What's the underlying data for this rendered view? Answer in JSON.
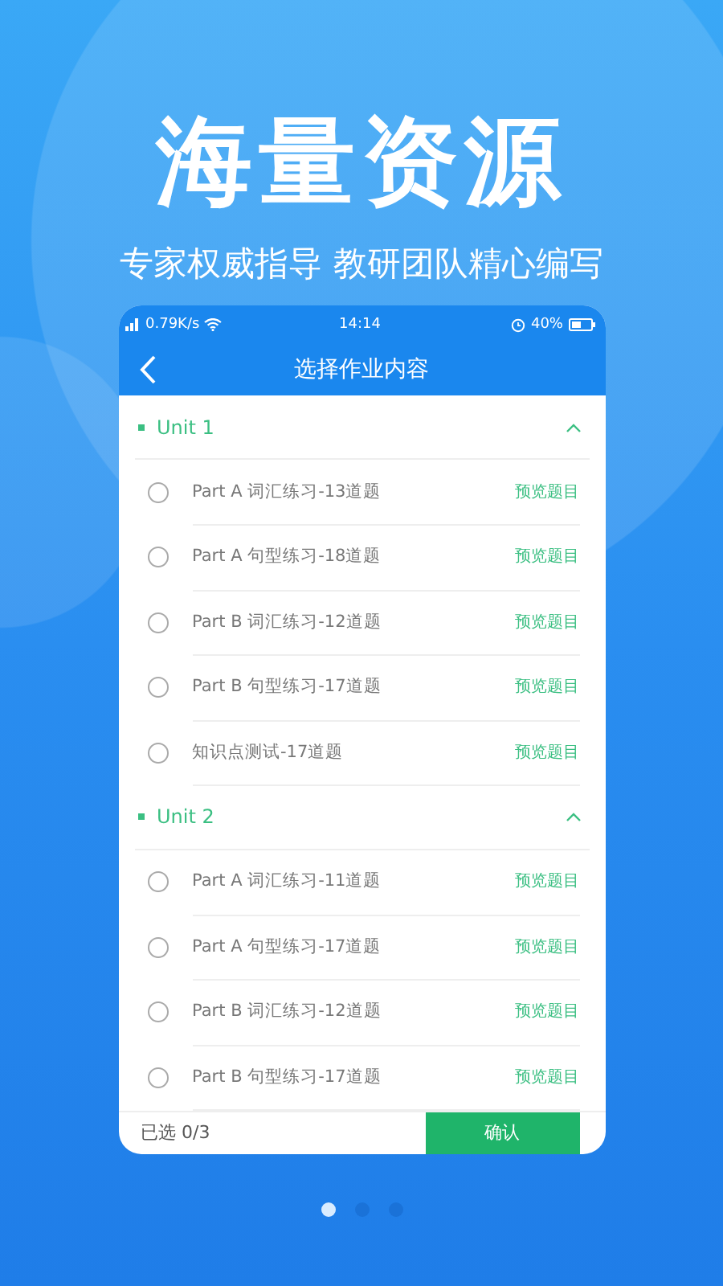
{
  "headline": "海量资源",
  "subtitle": "专家权威指导 教研团队精心编写",
  "status_bar": {
    "network": "0.79K/s",
    "time": "14:14",
    "battery": "40%"
  },
  "header": {
    "title": "选择作业内容"
  },
  "units": [
    {
      "name": "Unit 1",
      "expanded": true,
      "items": [
        {
          "title": "Part A 词汇练习-13道题",
          "selected": false,
          "action": "预览题目"
        },
        {
          "title": "Part A 句型练习-18道题",
          "selected": false,
          "action": "预览题目"
        },
        {
          "title": "Part B 词汇练习-12道题",
          "selected": false,
          "action": "预览题目"
        },
        {
          "title": "Part B 句型练习-17道题",
          "selected": false,
          "action": "预览题目"
        },
        {
          "title": "知识点测试-17道题",
          "selected": false,
          "action": "预览题目"
        }
      ]
    },
    {
      "name": "Unit 2",
      "expanded": true,
      "items": [
        {
          "title": "Part A 词汇练习-11道题",
          "selected": false,
          "action": "预览题目"
        },
        {
          "title": "Part A 句型练习-17道题",
          "selected": false,
          "action": "预览题目"
        },
        {
          "title": "Part B 词汇练习-12道题",
          "selected": false,
          "action": "预览题目"
        },
        {
          "title": "Part B 句型练习-17道题",
          "selected": false,
          "action": "预览题目"
        }
      ]
    }
  ],
  "footer": {
    "count": "已选 0/3",
    "confirm": "确认"
  },
  "pager": [
    {
      "selected": true
    },
    {
      "selected": false
    },
    {
      "selected": false
    }
  ]
}
